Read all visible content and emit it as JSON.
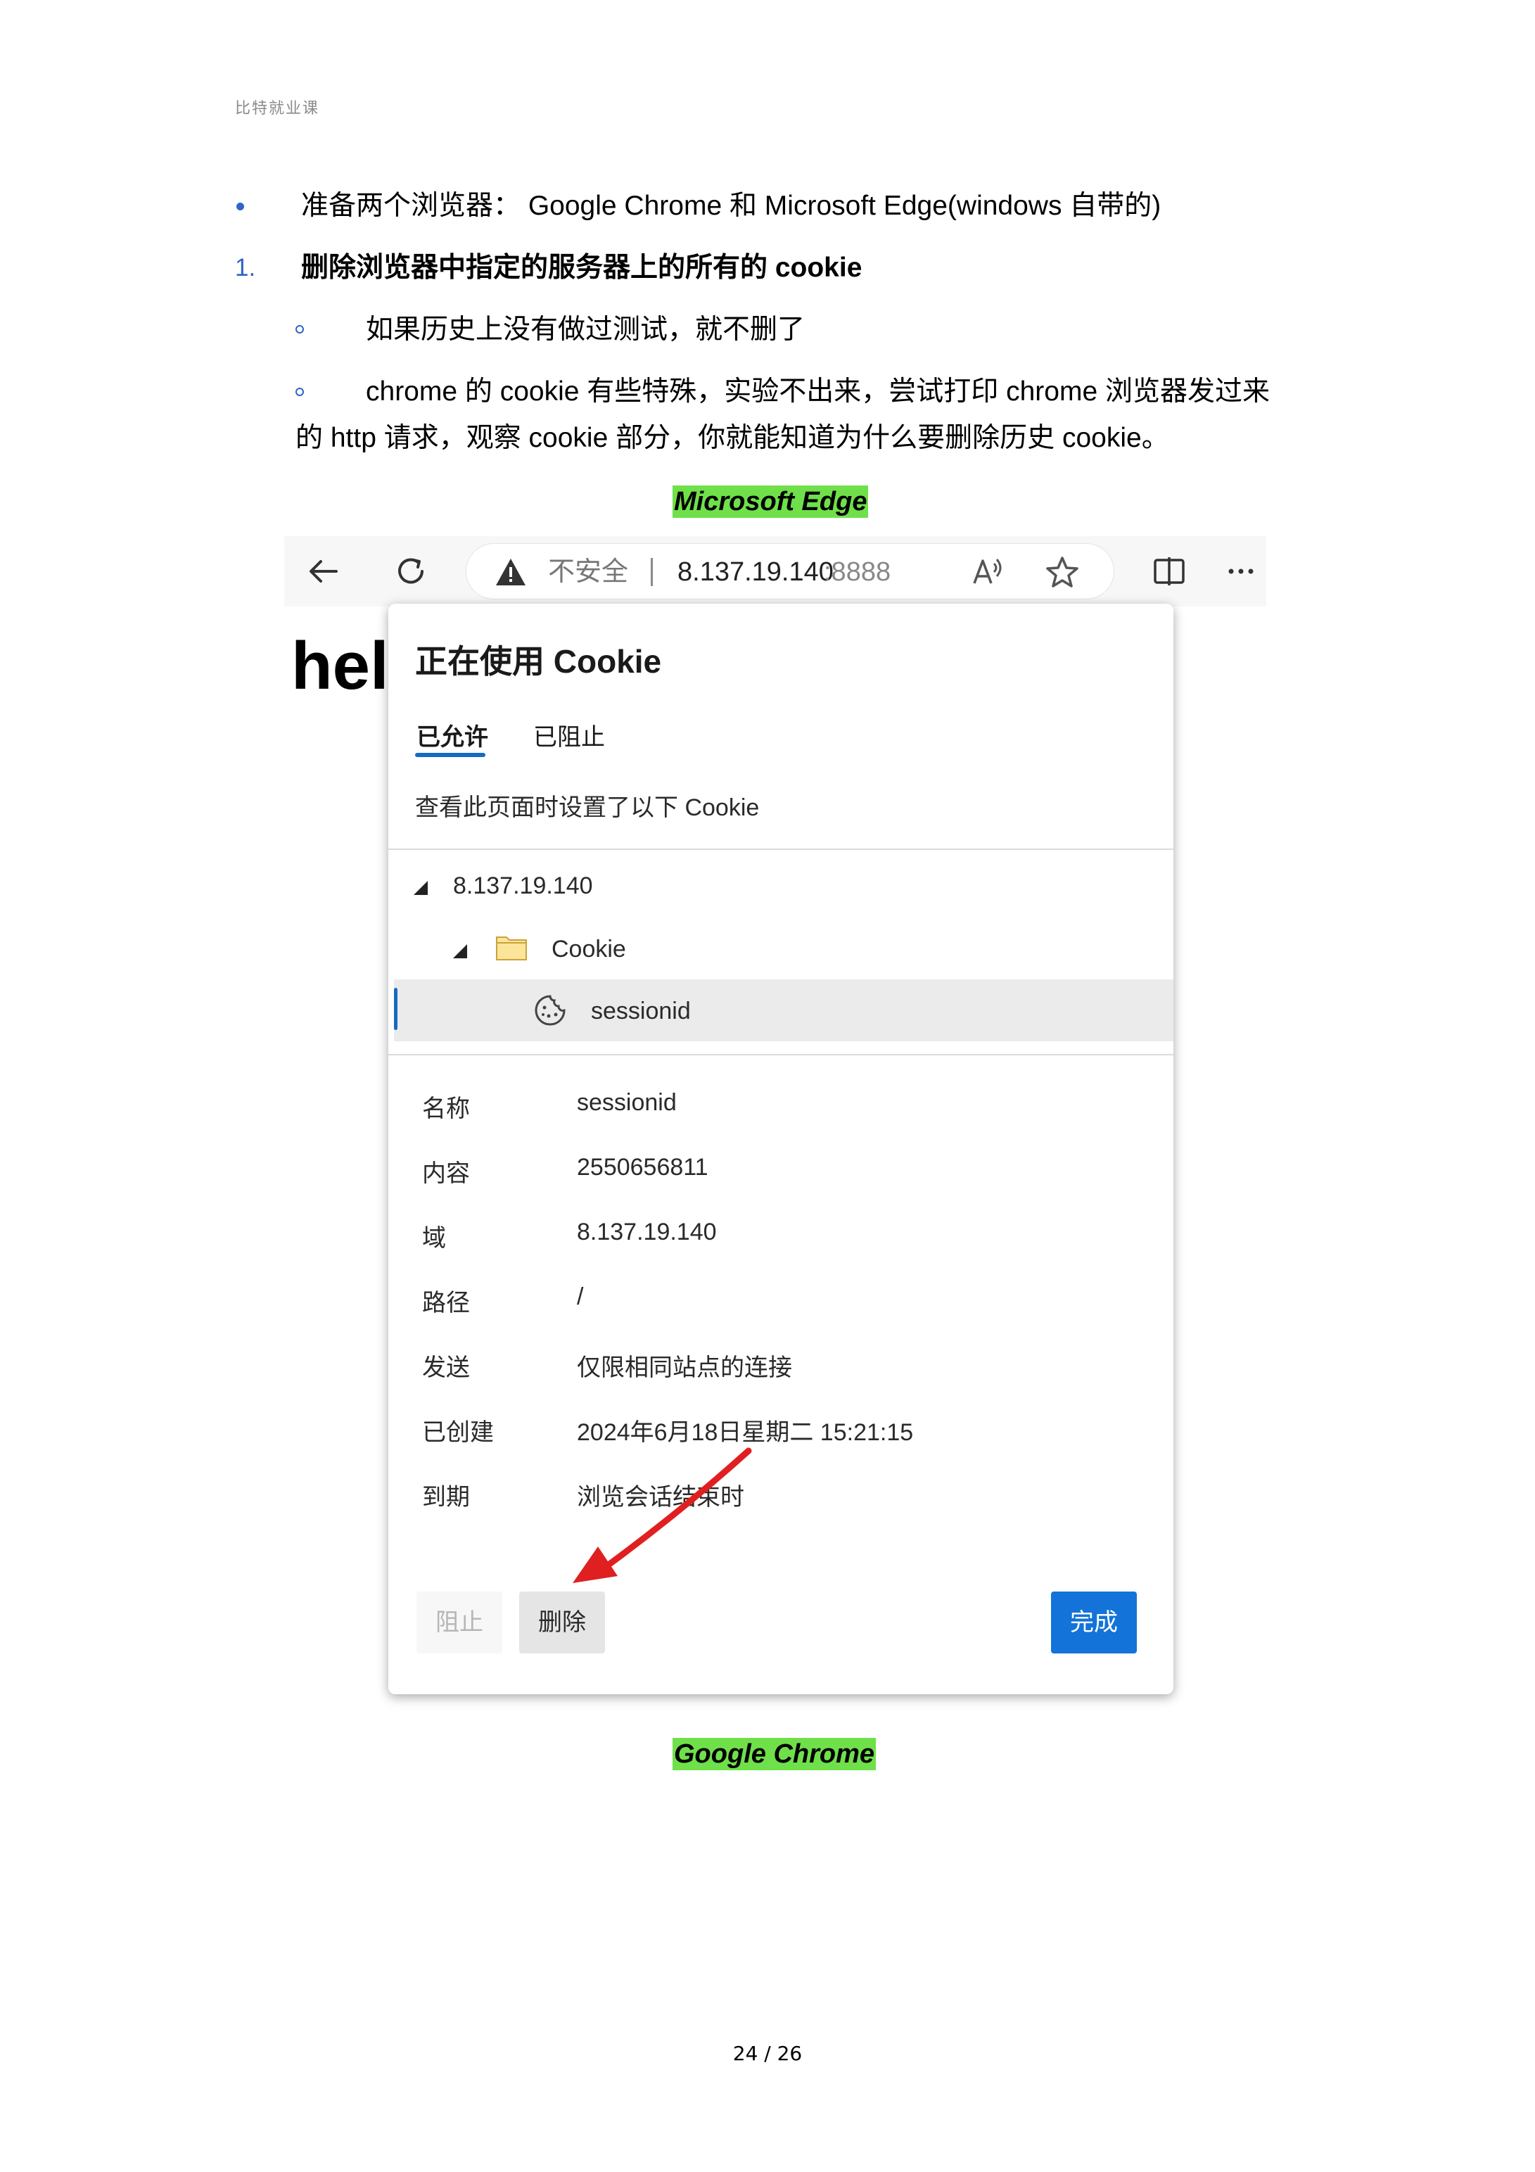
{
  "header": {
    "brand": "比特就业课"
  },
  "body": {
    "bullet1": "准备两个浏览器： Google Chrome 和 Microsoft Edge(windows 自带的)",
    "item1_number": "1.",
    "item1_title": "删除浏览器中指定的服务器上的所有的 cookie",
    "sub1": "如果历史上没有做过测试，就不删了",
    "sub2_line1": "chrome 的 cookie 有些特殊，实验不出来，尝试打印 chrome 浏览器发过来",
    "sub2_line2": "的 http 请求，观察 cookie 部分，你就能知道为什么要删除历史 cookie。",
    "caption_edge": "Microsoft Edge",
    "caption_chrome": "Google Chrome"
  },
  "browser": {
    "security_label": "不安全",
    "url_host": "8.137.19.140",
    "url_port": ":8888",
    "page_text": "hel",
    "icons": [
      "back-icon",
      "refresh-icon",
      "warning-icon",
      "read-aloud-icon",
      "favorite-icon",
      "split-screen-icon",
      "more-icon"
    ]
  },
  "cookie_popup": {
    "title": "正在使用 Cookie",
    "tabs": [
      "已允许",
      "已阻止"
    ],
    "active_tab": "已允许",
    "subtitle": "查看此页面时设置了以下 Cookie",
    "tree": {
      "site": "8.137.19.140",
      "folder": "Cookie",
      "item": "sessionid"
    },
    "details": [
      {
        "key": "名称",
        "value": "sessionid"
      },
      {
        "key": "内容",
        "value": "2550656811"
      },
      {
        "key": "域",
        "value": "8.137.19.140"
      },
      {
        "key": "路径",
        "value": "/"
      },
      {
        "key": "发送",
        "value": "仅限相同站点的连接"
      },
      {
        "key": "已创建",
        "value": "2024年6月18日星期二 15:21:15"
      },
      {
        "key": "到期",
        "value": "浏览会话结束时"
      }
    ],
    "buttons": {
      "block": "阻止",
      "delete": "删除",
      "done": "完成"
    },
    "accent_color": "#1373d8"
  },
  "footer": {
    "page": "24 / 26"
  },
  "colors": {
    "highlight": "#6fe04a",
    "list_marker": "#2f64c8",
    "annotation_arrow": "#e02020"
  }
}
